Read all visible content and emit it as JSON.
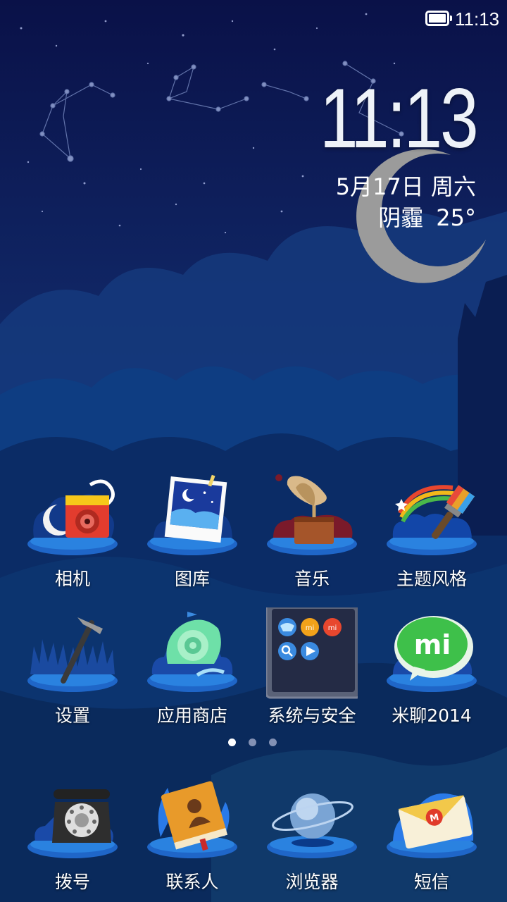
{
  "status_bar": {
    "time": "11:13",
    "battery_icon": "battery-icon"
  },
  "widget": {
    "clock": "11:13",
    "date": "5月17日",
    "weekday": "周六",
    "weather": "阴霾",
    "temperature": "25°"
  },
  "apps": [
    {
      "label": "相机",
      "icon": "camera-icon"
    },
    {
      "label": "图库",
      "icon": "gallery-icon"
    },
    {
      "label": "音乐",
      "icon": "music-gramophone-icon"
    },
    {
      "label": "主题风格",
      "icon": "theme-brush-icon"
    },
    {
      "label": "设置",
      "icon": "settings-hammer-icon"
    },
    {
      "label": "应用商店",
      "icon": "app-store-icon"
    },
    {
      "label": "系统与安全",
      "icon": "system-security-folder-icon"
    },
    {
      "label": "米聊2014",
      "icon": "miliao-icon"
    }
  ],
  "folder_icon_letters": {
    "mi1": "mi",
    "mi2": "mi"
  },
  "miliao_badge": "mi",
  "page_indicator": {
    "pages": 3,
    "current": 1
  },
  "dock": [
    {
      "label": "拨号",
      "icon": "phone-dialer-icon"
    },
    {
      "label": "联系人",
      "icon": "contacts-book-icon"
    },
    {
      "label": "浏览器",
      "icon": "browser-globe-icon"
    },
    {
      "label": "短信",
      "icon": "messages-envelope-icon"
    }
  ],
  "colors": {
    "sky_top": "#0b1450",
    "sky_bottom": "#12306e",
    "hills": "#0e4a8c",
    "moon": "#9b9b9b",
    "pedestal": "#1f66c8"
  }
}
